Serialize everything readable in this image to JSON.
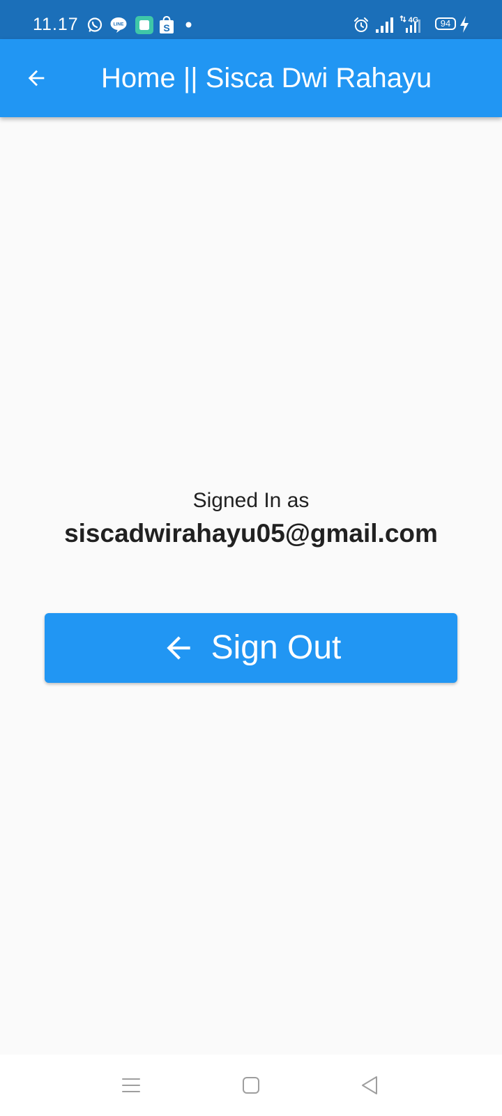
{
  "status_bar": {
    "time": "11.17",
    "notification_icons": [
      "whatsapp-icon",
      "line-icon",
      "square-app-icon",
      "shopping-bag-icon",
      "dot-icon"
    ],
    "system_icons": [
      "alarm-icon",
      "signal-icon",
      "4g-signal-icon",
      "battery-icon",
      "charging-icon"
    ],
    "network_label": "4G",
    "battery_level": "94",
    "background_color": "#1B6FB9"
  },
  "app_bar": {
    "title": "Home || Sisca Dwi Rahayu",
    "back_icon": "arrow-back-icon",
    "background_color": "#2196F3"
  },
  "main": {
    "signed_in_label": "Signed In as",
    "email": "siscadwirahayu05@gmail.com"
  },
  "sign_out_button": {
    "label": "Sign Out",
    "icon": "arrow-back-icon",
    "background_color": "#2196F3"
  },
  "nav_bar": {
    "buttons": [
      "menu-icon",
      "home-square-icon",
      "back-triangle-icon"
    ]
  }
}
